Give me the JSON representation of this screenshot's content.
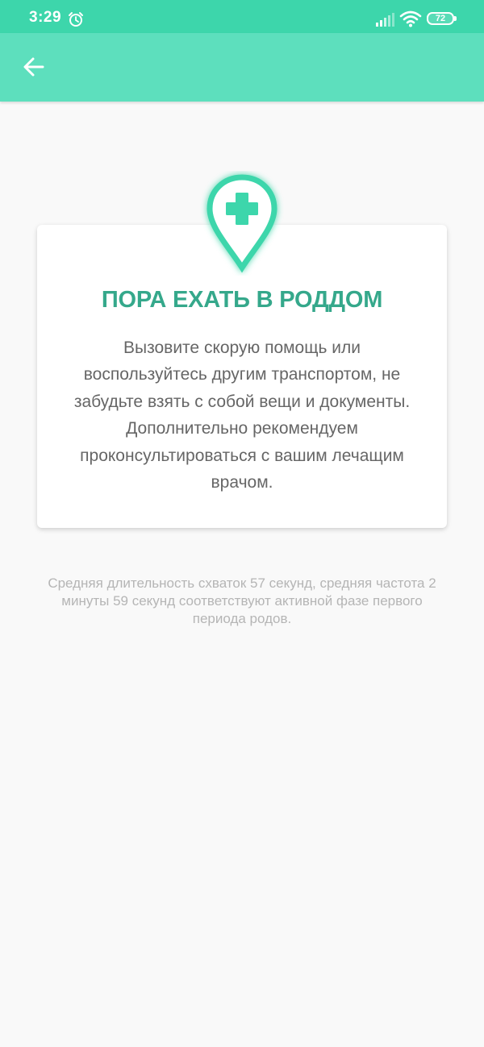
{
  "status_bar": {
    "time": "3:29",
    "battery_level": "72",
    "icons": [
      "alarm-icon",
      "signal-icon",
      "wifi-icon",
      "battery-icon"
    ]
  },
  "app_bar": {
    "back_icon": "arrow-left-icon"
  },
  "card": {
    "icon": "location-pin-medical-cross-icon",
    "title": "ПОРА ЕХАТЬ В РОДДОМ",
    "body": "Вызовите скорую помощь или воспользуйтесь другим транспортом, не забудьте взять с собой вещи и документы. Дополнительно рекомендуем проконсультироваться с вашим лечащим врачом."
  },
  "footnote": "Средняя длительность схваток 57 секунд, средняя частота 2 минуты 59 секунд соответствуют активной фазе первого периода родов.",
  "colors": {
    "status_bar": "#3dd6ab",
    "app_bar": "#5ddfbd",
    "accent": "#3dd6ab",
    "title": "#35a88b",
    "background": "#f9f9f9"
  }
}
